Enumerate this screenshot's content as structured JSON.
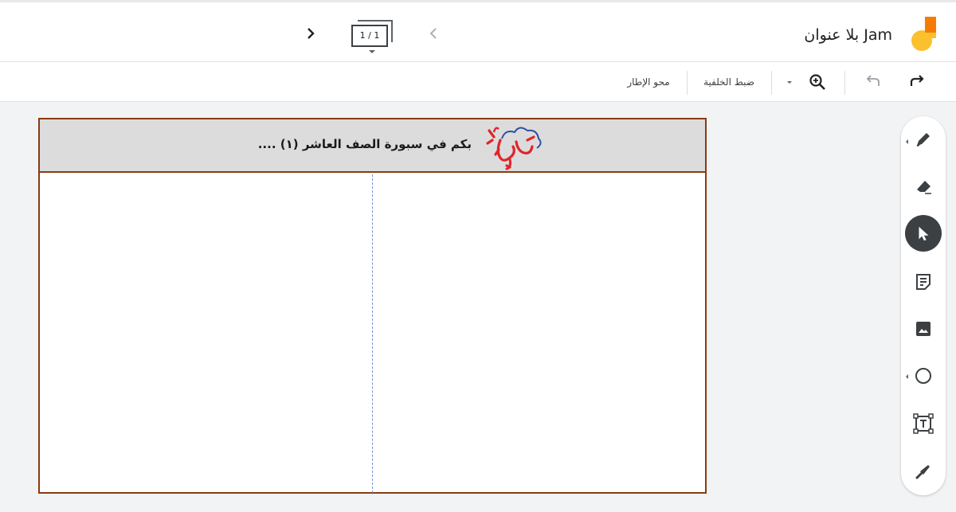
{
  "header": {
    "title": "Jam بلا عنوان",
    "frame_indicator": "1 / 1"
  },
  "toolbar": {
    "clear_frame_label": "محو الإطار",
    "set_background_label": "ضبط الخلفية"
  },
  "canvas": {
    "banner_text": "بكم في سبورة الصف العاشر (١) ....",
    "banner_logo_text": "مرحبا"
  },
  "icons": {
    "logo": "jamboard-logo-icon",
    "prev": "chevron-left-icon",
    "next": "chevron-right-icon",
    "redo": "redo-icon",
    "undo": "undo-icon",
    "zoom": "zoom-in-icon",
    "tools": [
      "pen-icon",
      "eraser-icon",
      "select-icon",
      "sticky-note-icon",
      "image-icon",
      "circle-icon",
      "text-box-icon",
      "laser-icon"
    ]
  },
  "colors": {
    "frame_border": "#8b3a0f",
    "banner_bg": "#dcdcdc",
    "logo_orange": "#f57c00",
    "logo_yellow": "#fbc02d",
    "active_tool": "#3c4043"
  }
}
